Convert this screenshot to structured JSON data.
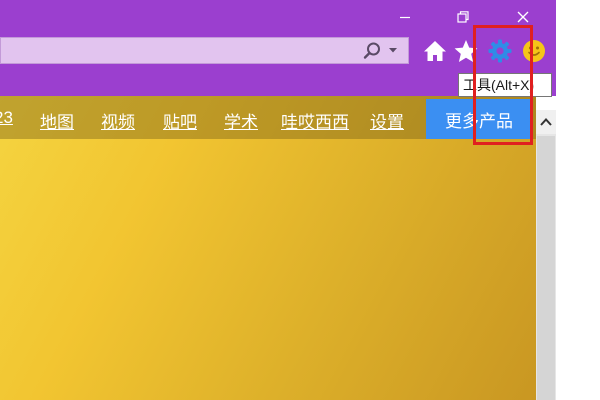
{
  "browser": {
    "tooltip": "工具(Alt+X)"
  },
  "navbar": {
    "links": [
      "23",
      "地图",
      "视频",
      "贴吧",
      "学术",
      "哇哎西西",
      "设置"
    ],
    "more_label": "更多产品"
  },
  "icons": {
    "minimize": "minimize-icon",
    "restore": "restore-icon",
    "close": "close-icon",
    "search": "search-icon",
    "dropdown": "chevron-down-icon",
    "home": "home-icon",
    "favorites": "star-icon",
    "tools": "gear-icon",
    "feedback": "smiley-icon",
    "scroll_up": "chevron-up-icon"
  },
  "colors": {
    "titlebar": "#9b3fcf",
    "address_bar": "#e2c4ef",
    "tools_icon": "#2f8ce6",
    "smiley": "#f5c518",
    "highlight": "#e02020",
    "more_button": "#3b8ff2",
    "page_gradient": [
      "#f4d440",
      "#c99722"
    ]
  }
}
